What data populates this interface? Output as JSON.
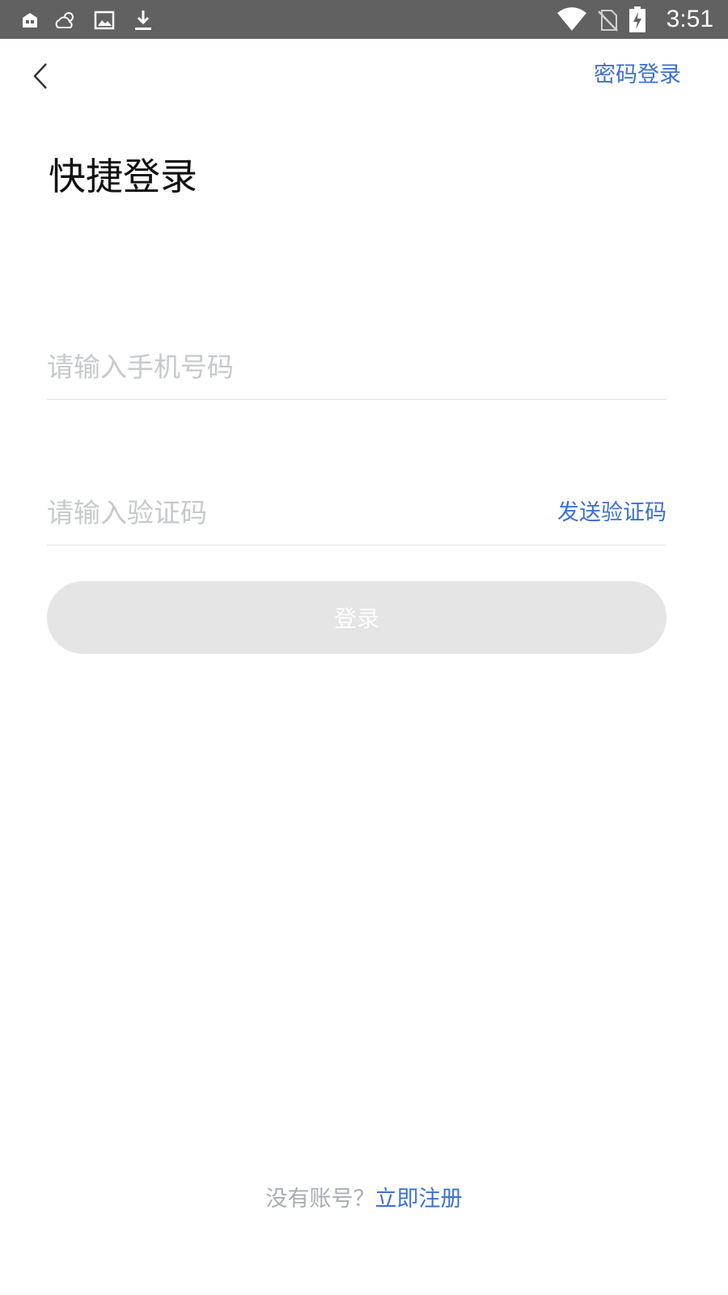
{
  "status_bar": {
    "time": "3:51",
    "icons": [
      "app-notification-icon",
      "weather-icon",
      "image-icon",
      "download-icon",
      "wifi-icon",
      "no-sim-icon",
      "battery-charging-icon"
    ]
  },
  "header": {
    "back_icon": "chevron-left-icon",
    "password_login_label": "密码登录"
  },
  "title": "快捷登录",
  "form": {
    "phone_placeholder": "请输入手机号码",
    "phone_value": "",
    "code_placeholder": "请输入验证码",
    "code_value": "",
    "send_code_label": "发送验证码",
    "login_label": "登录"
  },
  "footer": {
    "no_account_text": "没有账号？",
    "register_label": "立即注册"
  },
  "colors": {
    "accent": "#3d6fd6",
    "status_bar_bg": "#616161",
    "button_disabled_bg": "#e5e5e5",
    "placeholder": "#c7c9cc"
  }
}
